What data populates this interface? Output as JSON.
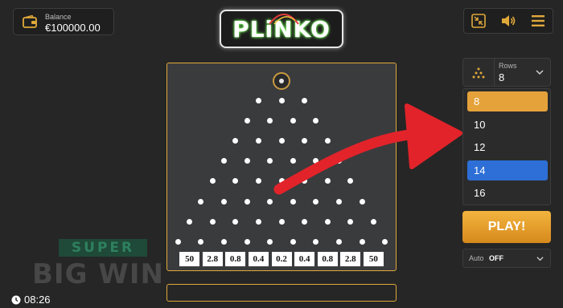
{
  "header": {
    "balance_label": "Balance",
    "balance_value": "€100000.00",
    "logo_text": "PLiNKO"
  },
  "top_buttons": [
    {
      "icon": "collapse-icon"
    },
    {
      "icon": "sound-icon"
    },
    {
      "icon": "menu-icon"
    }
  ],
  "board": {
    "peg_rows": [
      3,
      4,
      5,
      6,
      7,
      8,
      9,
      10
    ],
    "multipliers": [
      "50",
      "2.8",
      "0.8",
      "0.4",
      "0.2",
      "0.4",
      "0.8",
      "2.8",
      "50"
    ]
  },
  "rows_select": {
    "label": "Rows",
    "value": "8",
    "options": [
      "8",
      "10",
      "12",
      "14",
      "16"
    ],
    "selected_index": 0,
    "hovered_index": 3
  },
  "play_button": "PLAY!",
  "auto": {
    "label": "Auto",
    "value": "OFF"
  },
  "clock": "08:26",
  "watermark": {
    "top": "SUPER",
    "bottom": "BIG WIN"
  },
  "colors": {
    "accent": "#e0a93a",
    "selected_option": "#e5a23a",
    "hovered_option": "#2d6fd6",
    "arrow": "#e2232a",
    "board": "#3a3b3d"
  }
}
